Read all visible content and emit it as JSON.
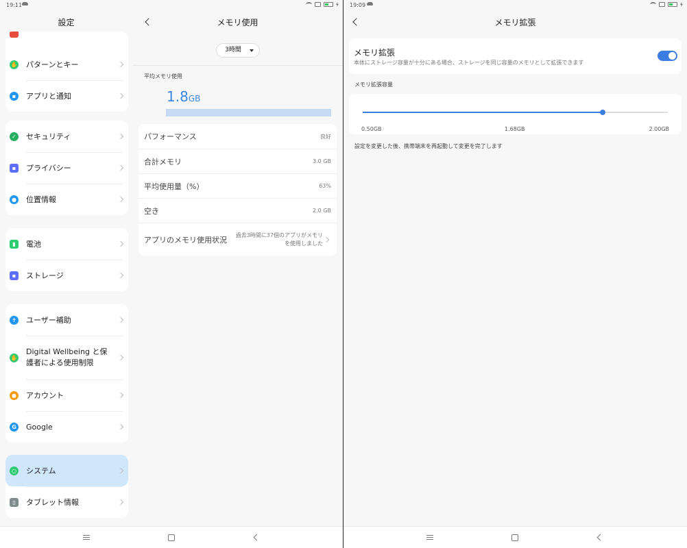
{
  "left_status": {
    "time": "19:11"
  },
  "right_status": {
    "time": "19:09"
  },
  "settings": {
    "title": "設定",
    "groups": [
      {
        "items": [
          {
            "label": "パターンとキー",
            "icon": "hand-icon",
            "color": "#2ecc71"
          },
          {
            "label": "アプリと通知",
            "icon": "apps-icon",
            "color": "#2196f3"
          }
        ]
      },
      {
        "items": [
          {
            "label": "セキュリティ",
            "icon": "shield-icon",
            "color": "#27ae60"
          },
          {
            "label": "プライバシー",
            "icon": "lock-icon",
            "color": "#5b6ef5"
          },
          {
            "label": "位置情報",
            "icon": "location-icon",
            "color": "#2196f3"
          }
        ]
      },
      {
        "items": [
          {
            "label": "電池",
            "icon": "battery-icon",
            "color": "#2ecc71"
          },
          {
            "label": "ストレージ",
            "icon": "storage-icon",
            "color": "#5b6ef5"
          }
        ]
      },
      {
        "items": [
          {
            "label": "ユーザー補助",
            "icon": "accessibility-icon",
            "color": "#2196f3"
          },
          {
            "label": "Digital Wellbeing と保護者による使用制限",
            "icon": "wellbeing-icon",
            "color": "#2ecc71"
          },
          {
            "label": "アカウント",
            "icon": "account-icon",
            "color": "#f39c12"
          },
          {
            "label": "Google",
            "icon": "google-icon",
            "color": "#2196f3"
          }
        ]
      },
      {
        "items": [
          {
            "label": "システム",
            "icon": "system-icon",
            "color": "#2ecc71"
          },
          {
            "label": "タブレット情報",
            "icon": "tablet-info-icon",
            "color": "#7f8c8d"
          }
        ]
      }
    ]
  },
  "memory": {
    "title": "メモリ使用",
    "period": "3時間",
    "avg_label": "平均メモリ使用",
    "avg_value": "1.8",
    "avg_unit": "GB",
    "rows": [
      {
        "label": "パフォーマンス",
        "value": "良好"
      },
      {
        "label": "合計メモリ",
        "value": "3.0 GB"
      },
      {
        "label": "平均使用量（%）",
        "value": "63%"
      },
      {
        "label": "空き",
        "value": "2.0 GB"
      }
    ],
    "app_usage": {
      "label": "アプリのメモリ使用状況",
      "desc": "過去3時間に37個のアプリがメモリを使用しました"
    }
  },
  "expansion": {
    "title": "メモリ拡張",
    "toggle_title": "メモリ拡張",
    "toggle_desc": "本体にストレージ容量が十分にある場合、ストレージを同じ容量のメモリとして拡張できます",
    "toggle_on": true,
    "accent": "#3b7de0",
    "section_label": "メモリ拡張容量",
    "slider": {
      "min_label": "0.50GB",
      "mid_label": "1.68GB",
      "max_label": "2.00GB",
      "min": 0.5,
      "max": 2.0,
      "value": 1.68
    },
    "note": "設定を変更した後、携帯端末を再起動して変更を完了します"
  }
}
